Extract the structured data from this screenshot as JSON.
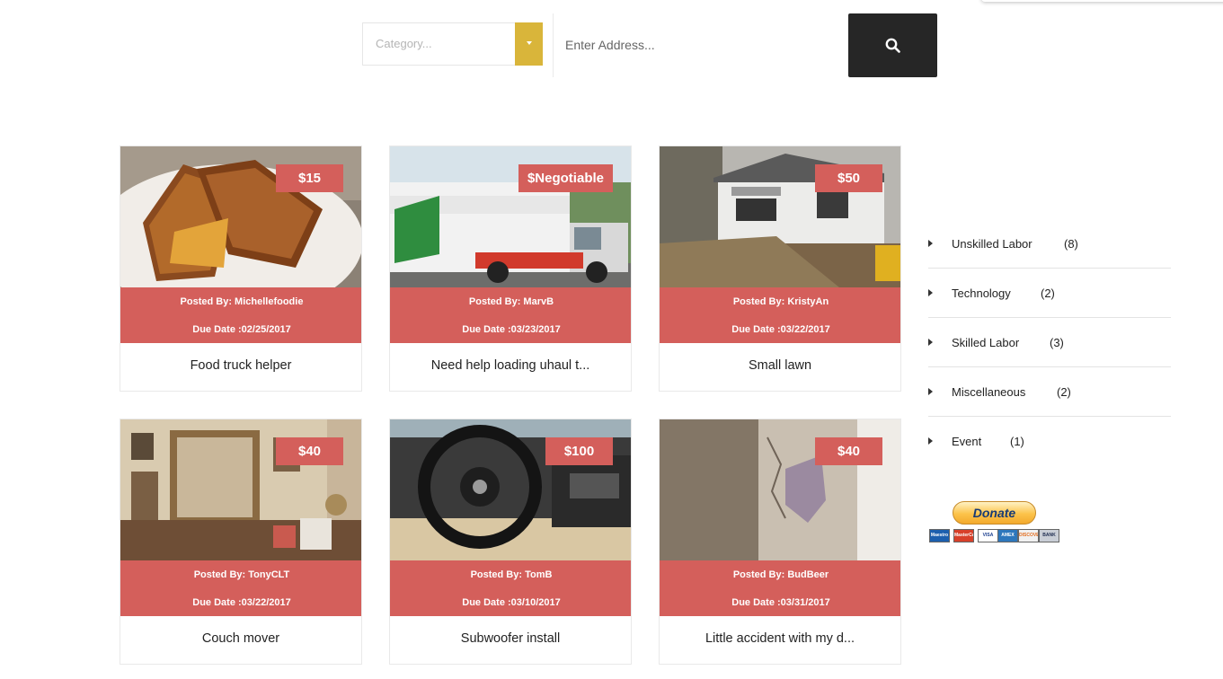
{
  "search": {
    "category_placeholder": "Category...",
    "address_placeholder": "Enter Address..."
  },
  "listings": [
    {
      "price": "$15",
      "posted_by": "Posted By: Michellefoodie",
      "due_date": "Due Date :02/25/2017",
      "title": "Food truck helper",
      "photo": "grilled-cheese-sandwich"
    },
    {
      "price": "$Negotiable",
      "posted_by": "Posted By: MarvB",
      "due_date": "Due Date :03/23/2017",
      "title": "Need help loading uhaul t...",
      "photo": "uhaul-truck"
    },
    {
      "price": "$50",
      "posted_by": "Posted By: KristyAn",
      "due_date": "Due Date :03/22/2017",
      "title": "Small lawn",
      "photo": "house-lawn"
    },
    {
      "price": "$40",
      "posted_by": "Posted By: TonyCLT",
      "due_date": "Due Date :03/22/2017",
      "title": "Couch mover",
      "photo": "living-room-couch"
    },
    {
      "price": "$100",
      "posted_by": "Posted By: TomB",
      "due_date": "Due Date :03/10/2017",
      "title": "Subwoofer install",
      "photo": "car-interior"
    },
    {
      "price": "$40",
      "posted_by": "Posted By: BudBeer",
      "due_date": "Due Date :03/31/2017",
      "title": "Little accident with my d...",
      "photo": "damaged-wall"
    }
  ],
  "categories": [
    {
      "name": "Unskilled Labor",
      "count": "(8)"
    },
    {
      "name": "Technology",
      "count": "(2)"
    },
    {
      "name": "Skilled Labor",
      "count": "(3)"
    },
    {
      "name": "Miscellaneous",
      "count": "(2)"
    },
    {
      "name": "Event",
      "count": "(1)"
    }
  ],
  "donate": {
    "label": "Donate",
    "cards": [
      "Maestro",
      "MasterCard",
      "VISA",
      "AMEX",
      "DISCOVER",
      "BANK"
    ]
  },
  "colors": {
    "accent_red": "#d45f5b",
    "accent_gold": "#d9b53a",
    "search_button": "#262626"
  },
  "icons": {
    "search_button": "search-icon",
    "category_caret": "caret-down-icon",
    "category_arrow": "caret-right-icon"
  }
}
